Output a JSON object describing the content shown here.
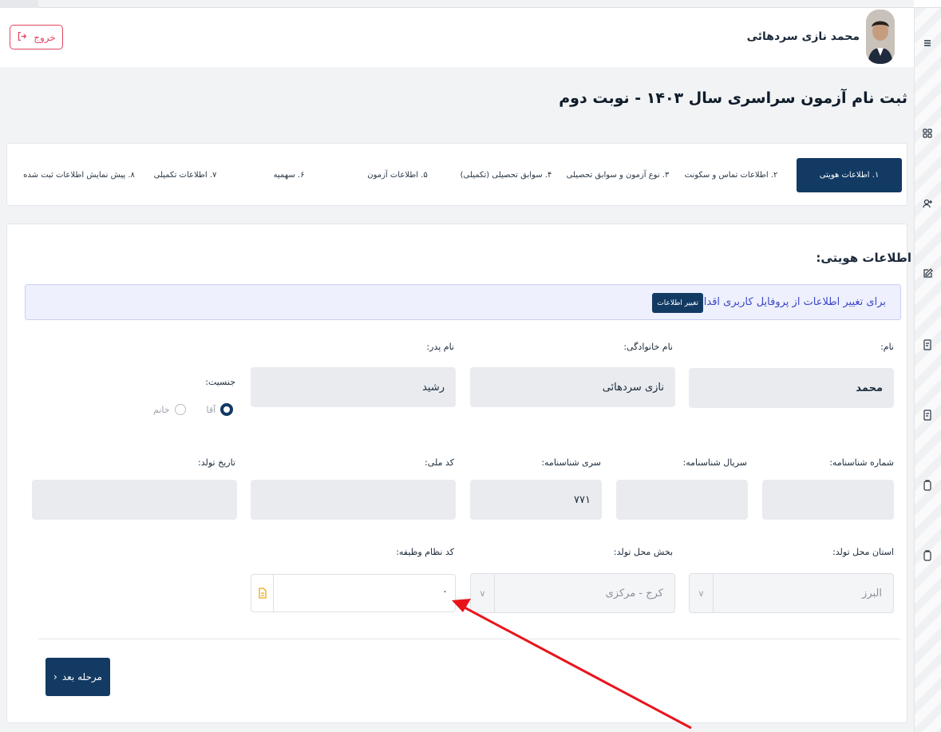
{
  "header": {
    "user_name": "محمد نازی سردهائی",
    "logout_label": "خروج"
  },
  "page_title": "ثبت نام آزمون سراسری سال ۱۴۰۳ - نوبت دوم",
  "steps": [
    {
      "label": "۱. اطلاعات هویتی",
      "active": true
    },
    {
      "label": "۲. اطلاعات تماس و سکونت"
    },
    {
      "label": "۳. نوع آزمون و سوابق تحصیلی"
    },
    {
      "label": "۴. سوابق تحصیلی (تکمیلی)"
    },
    {
      "label": "۵. اطلاعات آزمون"
    },
    {
      "label": "۶. سهمیه"
    },
    {
      "label": "۷. اطلاعات تکمیلی"
    },
    {
      "label": "۸. پیش نمایش اطلاعات ثبت شده"
    }
  ],
  "section_title": "اطلاعات هویتی:",
  "info": {
    "text": "برای تغییر اطلاعات از پروفایل کاربری اقدام کنید.",
    "button": "تغییر اطلاعات"
  },
  "form": {
    "first_name": {
      "label": "نام:",
      "value": "محمد"
    },
    "last_name": {
      "label": "نام خانوادگی:",
      "value": "نازی سردهائی"
    },
    "father_name": {
      "label": "نام پدر:",
      "value": "رشید"
    },
    "gender": {
      "label": "جنسیت:",
      "options": [
        "آقا",
        "خانم"
      ],
      "selected": "آقا"
    },
    "birth_cert_number": {
      "label": "شماره شناسنامه:",
      "value": ""
    },
    "birth_cert_serial": {
      "label": "سریال شناسنامه:",
      "value": ""
    },
    "birth_cert_series": {
      "label": "سری شناسنامه:",
      "value": "۷۷۱"
    },
    "national_code": {
      "label": "کد ملی:",
      "value": ""
    },
    "birth_date": {
      "label": "تاریخ تولد:",
      "value": ""
    },
    "birth_province": {
      "label": "استان محل تولد:",
      "value": "البرز"
    },
    "birth_district": {
      "label": "بخش محل تولد:",
      "value": "کرج - مرکزی"
    },
    "military_code": {
      "label": "کد نظام وظیفه:",
      "value": "۰"
    }
  },
  "next_button": "مرحله بعد",
  "colors": {
    "primary": "#123a63",
    "danger": "#e0455f",
    "info_bg": "#eef0fd",
    "annotation_arrow": "#e8141c"
  },
  "icons": [
    "menu-icon",
    "grid-icon",
    "user-plus-icon",
    "edit-icon",
    "document-icon",
    "clipboard-icon",
    "logout-icon",
    "file-icon",
    "chevron-left-icon",
    "chevron-down-icon"
  ]
}
